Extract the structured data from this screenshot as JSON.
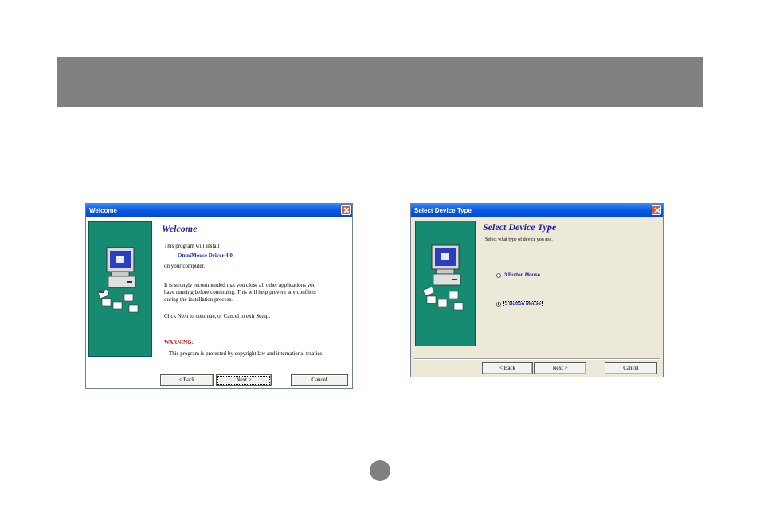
{
  "welcome_dialog": {
    "title": "Welcome",
    "heading": "Welcome",
    "line1": "This program will install",
    "product": "OmniMouse Driver 4.0",
    "line2": "on your computer.",
    "recommend1": "It is strongly recommended that you close all other applications you",
    "recommend2": "have running before continuing. This will help prevent any conflicts",
    "recommend3": "during the installation process.",
    "instruction": "Click Next to continue, or Cancel to exit Setup.",
    "warning_label": "WARNING:",
    "warning_text": "This program is protected by copyright law and international treaties.",
    "back_label": "< Back",
    "next_label": "Next >",
    "cancel_label": "Cancel"
  },
  "device_dialog": {
    "title": "Select Device Type",
    "heading": "Select Device Type",
    "prompt": "Select what type of device you use.",
    "option1": "3 Button Mouse",
    "option2": "5 Button Mouse",
    "selected_option": "5 Button Mouse",
    "back_label": "< Back",
    "next_label": "Next >",
    "cancel_label": "Cancel"
  },
  "colors": {
    "header_bar": "#808080",
    "side_panel": "#178a72",
    "titlebar": "#0a5be0",
    "heading": "#1f1f9a",
    "warning": "#cc1010"
  }
}
